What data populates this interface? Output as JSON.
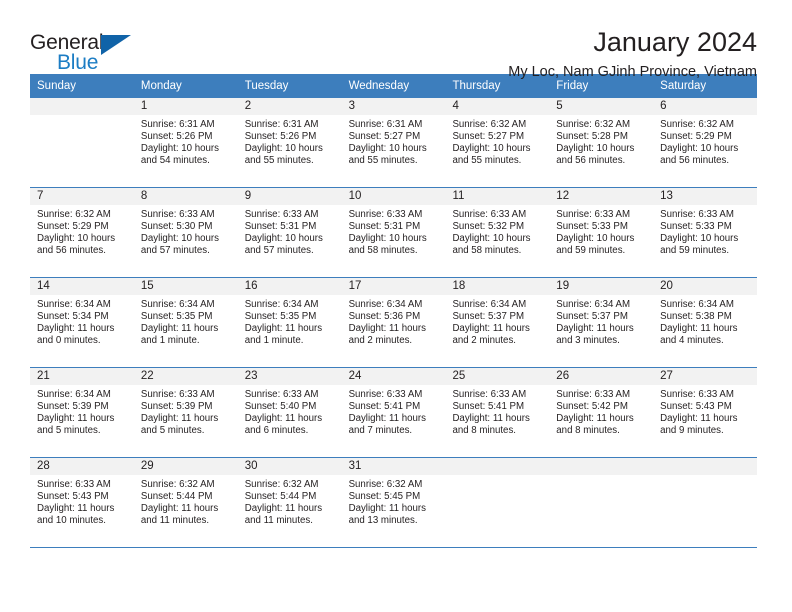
{
  "brand": {
    "name_part1": "General",
    "name_part2": "Blue",
    "triangle_color": "#1063a8",
    "blue_color": "#1c7dc4"
  },
  "header": {
    "title": "January 2024",
    "subtitle": "My Loc, Nam GJinh Province, Vietnam"
  },
  "theme": {
    "header_band": "#3d7ebd",
    "day_band": "#f2f2f2",
    "text": "#231f20"
  },
  "calendar": {
    "weekdays": [
      "Sunday",
      "Monday",
      "Tuesday",
      "Wednesday",
      "Thursday",
      "Friday",
      "Saturday"
    ],
    "weeks": [
      [
        {
          "day": "",
          "sunrise": "",
          "sunset": "",
          "daylight1": "",
          "daylight2": "",
          "empty": true
        },
        {
          "day": "1",
          "sunrise": "Sunrise: 6:31 AM",
          "sunset": "Sunset: 5:26 PM",
          "daylight1": "Daylight: 10 hours",
          "daylight2": "and 54 minutes."
        },
        {
          "day": "2",
          "sunrise": "Sunrise: 6:31 AM",
          "sunset": "Sunset: 5:26 PM",
          "daylight1": "Daylight: 10 hours",
          "daylight2": "and 55 minutes."
        },
        {
          "day": "3",
          "sunrise": "Sunrise: 6:31 AM",
          "sunset": "Sunset: 5:27 PM",
          "daylight1": "Daylight: 10 hours",
          "daylight2": "and 55 minutes."
        },
        {
          "day": "4",
          "sunrise": "Sunrise: 6:32 AM",
          "sunset": "Sunset: 5:27 PM",
          "daylight1": "Daylight: 10 hours",
          "daylight2": "and 55 minutes."
        },
        {
          "day": "5",
          "sunrise": "Sunrise: 6:32 AM",
          "sunset": "Sunset: 5:28 PM",
          "daylight1": "Daylight: 10 hours",
          "daylight2": "and 56 minutes."
        },
        {
          "day": "6",
          "sunrise": "Sunrise: 6:32 AM",
          "sunset": "Sunset: 5:29 PM",
          "daylight1": "Daylight: 10 hours",
          "daylight2": "and 56 minutes."
        }
      ],
      [
        {
          "day": "7",
          "sunrise": "Sunrise: 6:32 AM",
          "sunset": "Sunset: 5:29 PM",
          "daylight1": "Daylight: 10 hours",
          "daylight2": "and 56 minutes."
        },
        {
          "day": "8",
          "sunrise": "Sunrise: 6:33 AM",
          "sunset": "Sunset: 5:30 PM",
          "daylight1": "Daylight: 10 hours",
          "daylight2": "and 57 minutes."
        },
        {
          "day": "9",
          "sunrise": "Sunrise: 6:33 AM",
          "sunset": "Sunset: 5:31 PM",
          "daylight1": "Daylight: 10 hours",
          "daylight2": "and 57 minutes."
        },
        {
          "day": "10",
          "sunrise": "Sunrise: 6:33 AM",
          "sunset": "Sunset: 5:31 PM",
          "daylight1": "Daylight: 10 hours",
          "daylight2": "and 58 minutes."
        },
        {
          "day": "11",
          "sunrise": "Sunrise: 6:33 AM",
          "sunset": "Sunset: 5:32 PM",
          "daylight1": "Daylight: 10 hours",
          "daylight2": "and 58 minutes."
        },
        {
          "day": "12",
          "sunrise": "Sunrise: 6:33 AM",
          "sunset": "Sunset: 5:33 PM",
          "daylight1": "Daylight: 10 hours",
          "daylight2": "and 59 minutes."
        },
        {
          "day": "13",
          "sunrise": "Sunrise: 6:33 AM",
          "sunset": "Sunset: 5:33 PM",
          "daylight1": "Daylight: 10 hours",
          "daylight2": "and 59 minutes."
        }
      ],
      [
        {
          "day": "14",
          "sunrise": "Sunrise: 6:34 AM",
          "sunset": "Sunset: 5:34 PM",
          "daylight1": "Daylight: 11 hours",
          "daylight2": "and 0 minutes."
        },
        {
          "day": "15",
          "sunrise": "Sunrise: 6:34 AM",
          "sunset": "Sunset: 5:35 PM",
          "daylight1": "Daylight: 11 hours",
          "daylight2": "and 1 minute."
        },
        {
          "day": "16",
          "sunrise": "Sunrise: 6:34 AM",
          "sunset": "Sunset: 5:35 PM",
          "daylight1": "Daylight: 11 hours",
          "daylight2": "and 1 minute."
        },
        {
          "day": "17",
          "sunrise": "Sunrise: 6:34 AM",
          "sunset": "Sunset: 5:36 PM",
          "daylight1": "Daylight: 11 hours",
          "daylight2": "and 2 minutes."
        },
        {
          "day": "18",
          "sunrise": "Sunrise: 6:34 AM",
          "sunset": "Sunset: 5:37 PM",
          "daylight1": "Daylight: 11 hours",
          "daylight2": "and 2 minutes."
        },
        {
          "day": "19",
          "sunrise": "Sunrise: 6:34 AM",
          "sunset": "Sunset: 5:37 PM",
          "daylight1": "Daylight: 11 hours",
          "daylight2": "and 3 minutes."
        },
        {
          "day": "20",
          "sunrise": "Sunrise: 6:34 AM",
          "sunset": "Sunset: 5:38 PM",
          "daylight1": "Daylight: 11 hours",
          "daylight2": "and 4 minutes."
        }
      ],
      [
        {
          "day": "21",
          "sunrise": "Sunrise: 6:34 AM",
          "sunset": "Sunset: 5:39 PM",
          "daylight1": "Daylight: 11 hours",
          "daylight2": "and 5 minutes."
        },
        {
          "day": "22",
          "sunrise": "Sunrise: 6:33 AM",
          "sunset": "Sunset: 5:39 PM",
          "daylight1": "Daylight: 11 hours",
          "daylight2": "and 5 minutes."
        },
        {
          "day": "23",
          "sunrise": "Sunrise: 6:33 AM",
          "sunset": "Sunset: 5:40 PM",
          "daylight1": "Daylight: 11 hours",
          "daylight2": "and 6 minutes."
        },
        {
          "day": "24",
          "sunrise": "Sunrise: 6:33 AM",
          "sunset": "Sunset: 5:41 PM",
          "daylight1": "Daylight: 11 hours",
          "daylight2": "and 7 minutes."
        },
        {
          "day": "25",
          "sunrise": "Sunrise: 6:33 AM",
          "sunset": "Sunset: 5:41 PM",
          "daylight1": "Daylight: 11 hours",
          "daylight2": "and 8 minutes."
        },
        {
          "day": "26",
          "sunrise": "Sunrise: 6:33 AM",
          "sunset": "Sunset: 5:42 PM",
          "daylight1": "Daylight: 11 hours",
          "daylight2": "and 8 minutes."
        },
        {
          "day": "27",
          "sunrise": "Sunrise: 6:33 AM",
          "sunset": "Sunset: 5:43 PM",
          "daylight1": "Daylight: 11 hours",
          "daylight2": "and 9 minutes."
        }
      ],
      [
        {
          "day": "28",
          "sunrise": "Sunrise: 6:33 AM",
          "sunset": "Sunset: 5:43 PM",
          "daylight1": "Daylight: 11 hours",
          "daylight2": "and 10 minutes."
        },
        {
          "day": "29",
          "sunrise": "Sunrise: 6:32 AM",
          "sunset": "Sunset: 5:44 PM",
          "daylight1": "Daylight: 11 hours",
          "daylight2": "and 11 minutes."
        },
        {
          "day": "30",
          "sunrise": "Sunrise: 6:32 AM",
          "sunset": "Sunset: 5:44 PM",
          "daylight1": "Daylight: 11 hours",
          "daylight2": "and 11 minutes."
        },
        {
          "day": "31",
          "sunrise": "Sunrise: 6:32 AM",
          "sunset": "Sunset: 5:45 PM",
          "daylight1": "Daylight: 11 hours",
          "daylight2": "and 13 minutes."
        },
        {
          "day": "",
          "sunrise": "",
          "sunset": "",
          "daylight1": "",
          "daylight2": "",
          "empty": true
        },
        {
          "day": "",
          "sunrise": "",
          "sunset": "",
          "daylight1": "",
          "daylight2": "",
          "empty": true
        },
        {
          "day": "",
          "sunrise": "",
          "sunset": "",
          "daylight1": "",
          "daylight2": "",
          "empty": true
        }
      ]
    ]
  }
}
